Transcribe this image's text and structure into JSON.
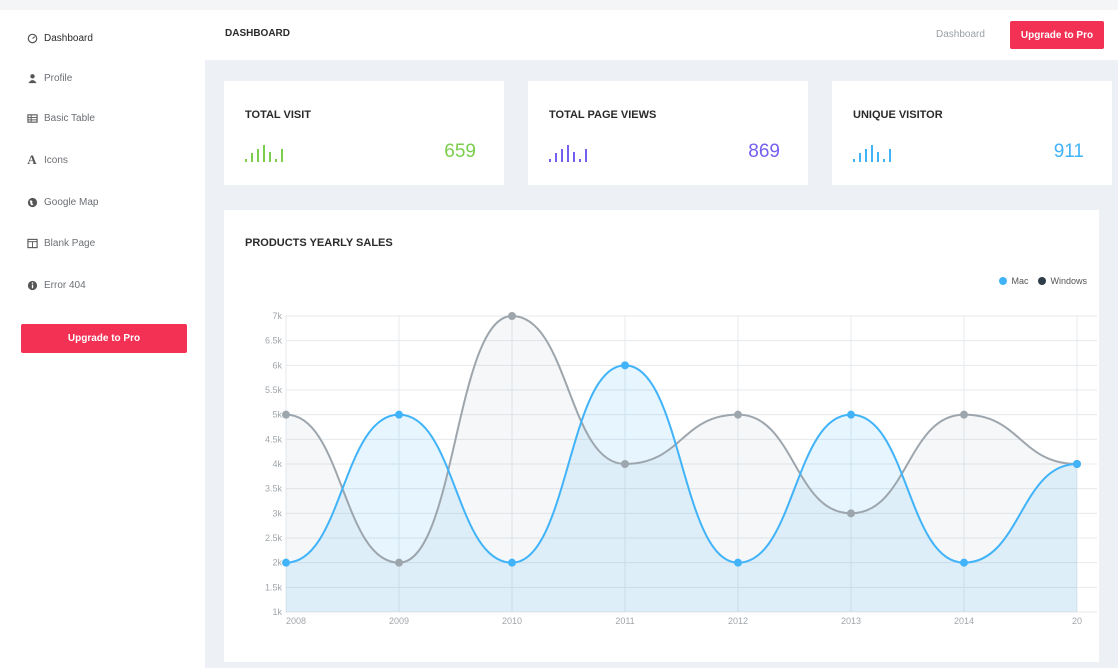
{
  "sidebar": {
    "items": [
      {
        "label": "Dashboard",
        "icon": "dashboard-icon",
        "active": true
      },
      {
        "label": "Profile",
        "icon": "user-icon"
      },
      {
        "label": "Basic Table",
        "icon": "table-icon"
      },
      {
        "label": "Icons",
        "icon": "font-icon"
      },
      {
        "label": "Google Map",
        "icon": "globe-icon"
      },
      {
        "label": "Blank Page",
        "icon": "columns-icon"
      },
      {
        "label": "Error 404",
        "icon": "info-icon"
      }
    ],
    "upgrade_label": "Upgrade to Pro"
  },
  "header": {
    "title": "DASHBOARD",
    "breadcrumb": "Dashboard",
    "upgrade_label": "Upgrade to Pro"
  },
  "stats": [
    {
      "title": "TOTAL VISIT",
      "value": "659",
      "color": "#7ace4c"
    },
    {
      "title": "TOTAL PAGE VIEWS",
      "value": "869",
      "color": "#7460ee"
    },
    {
      "title": "UNIQUE VISITOR",
      "value": "911",
      "color": "#41b3f9"
    }
  ],
  "colors": {
    "accent": "#f33155",
    "mac": "#41b3f9",
    "windows": "#9ea6ad"
  },
  "chart_data": {
    "type": "area",
    "title": "PRODUCTS YEARLY SALES",
    "categories": [
      "2008",
      "2009",
      "2010",
      "2011",
      "2012",
      "2013",
      "2014",
      "20"
    ],
    "series": [
      {
        "name": "Mac",
        "values": [
          2000,
          5000,
          2000,
          6000,
          2000,
          5000,
          2000,
          4000
        ]
      },
      {
        "name": "Windows",
        "values": [
          5000,
          2000,
          7000,
          4000,
          5000,
          3000,
          5000,
          4000
        ]
      }
    ],
    "y_ticks": [
      "1k",
      "1.5k",
      "2k",
      "2.5k",
      "3k",
      "3.5k",
      "4k",
      "4.5k",
      "5k",
      "5.5k",
      "6k",
      "6.5k",
      "7k"
    ],
    "ylim": [
      1000,
      7000
    ],
    "legend_position": "top-right",
    "grid": true
  }
}
